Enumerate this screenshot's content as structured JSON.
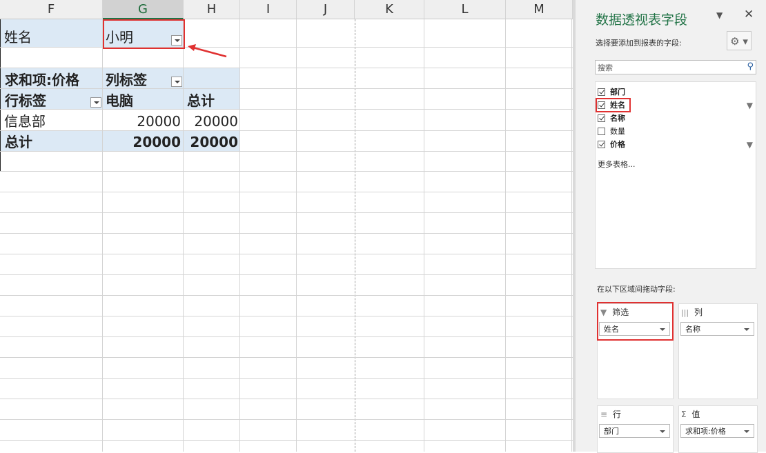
{
  "columns": [
    "F",
    "G",
    "H",
    "I",
    "J",
    "K",
    "L",
    "M"
  ],
  "pivot": {
    "filter_label": "姓名",
    "filter_value": "小明",
    "values_header": "求和项:价格",
    "column_labels": "列标签",
    "row_labels": "行标签",
    "col_computer": "电脑",
    "col_total": "总计",
    "row_name": "信息部",
    "row_value": "20000",
    "row_total_value": "20000",
    "grand_label": "总计",
    "grand_value": "20000",
    "grand_total_value": "20000"
  },
  "panel": {
    "title": "数据透视表字段",
    "subtitle": "选择要添加到报表的字段:",
    "search_placeholder": "搜索",
    "fields": [
      {
        "label": "部门",
        "checked": true,
        "filtered": false
      },
      {
        "label": "姓名",
        "checked": true,
        "filtered": true
      },
      {
        "label": "名称",
        "checked": true,
        "filtered": false
      },
      {
        "label": "数量",
        "checked": false,
        "filtered": false
      },
      {
        "label": "价格",
        "checked": true,
        "filtered": true
      }
    ],
    "more_tables": "更多表格...",
    "drag_hint": "在以下区域间拖动字段:",
    "areas": {
      "filters": {
        "label": "筛选",
        "item": "姓名"
      },
      "columns": {
        "label": "列",
        "item": "名称"
      },
      "rows": {
        "label": "行",
        "item": "部门"
      },
      "values": {
        "label": "值",
        "item": "求和项:价格"
      }
    }
  },
  "colors": {
    "accent": "#217346",
    "pivot_fill": "#dce9f5",
    "highlight": "#e03131"
  }
}
